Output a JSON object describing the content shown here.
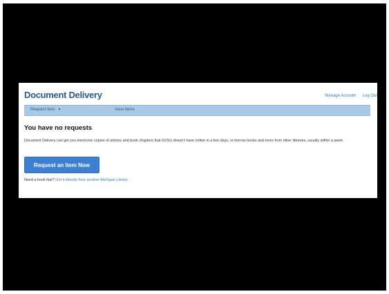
{
  "app": {
    "title": "Document Delivery"
  },
  "top_links": {
    "manage_account": "Manage Account",
    "log_out": "Log Out"
  },
  "nav": {
    "request_item": "Request Item",
    "request_caret": "▼",
    "view_items": "View Items"
  },
  "main": {
    "heading": "You have no requests",
    "description": "Document Delivery can get you electronic copies of articles and book chapters that GVSU doesn't have online in a few days, or borrow books and more from other libraries, usually within a week.",
    "cta_label": "Request an Item Now",
    "footnote_prefix": "Need a book fast?",
    "footnote_link": "Get it directly from another Michigan Library."
  },
  "colors": {
    "accent": "#3d7fd0",
    "nav_bar": "#a9c9e6",
    "title": "#2c5a8a",
    "link": "#3a7abf"
  }
}
